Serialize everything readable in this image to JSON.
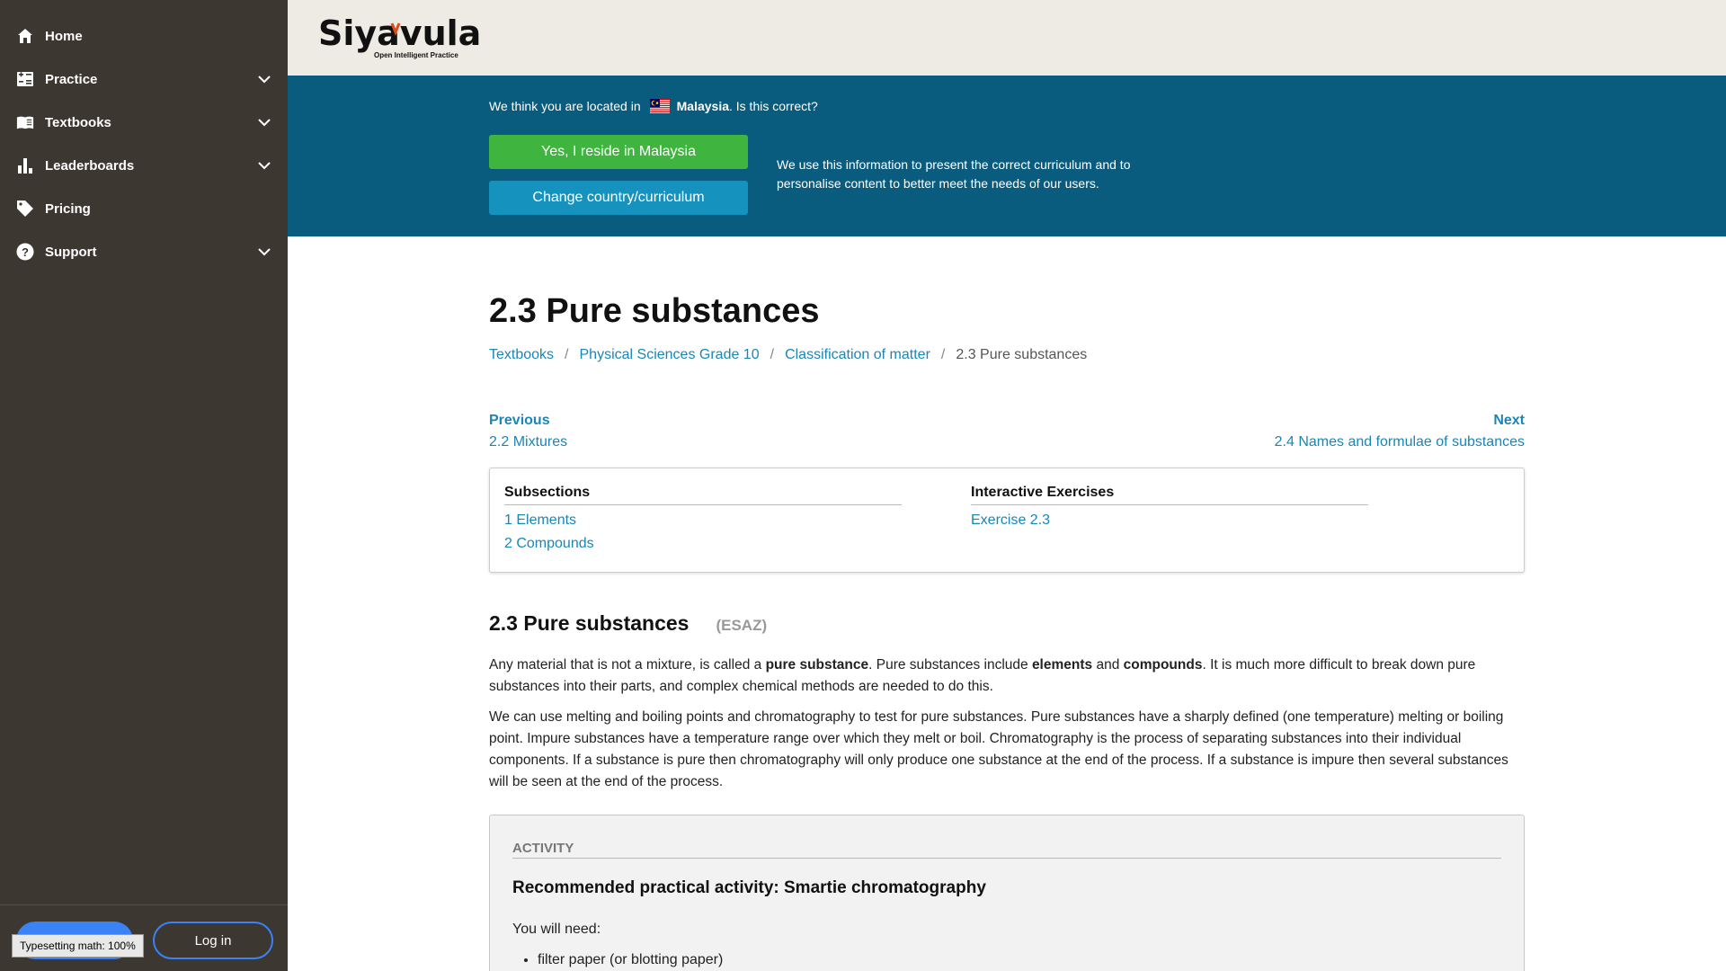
{
  "sidebar": {
    "items": [
      {
        "label": "Home",
        "icon": "home-icon"
      },
      {
        "label": "Practice",
        "icon": "practice-icon"
      },
      {
        "label": "Textbooks",
        "icon": "book-icon"
      },
      {
        "label": "Leaderboards",
        "icon": "bar-chart-icon"
      },
      {
        "label": "Pricing",
        "icon": "tag-icon"
      },
      {
        "label": "Support",
        "icon": "help-icon"
      }
    ],
    "login_label": "Log in",
    "typesetting_tip": "Typesetting math: 100%"
  },
  "header": {
    "logo_text": "Siyavula",
    "logo_tagline": "Open Intelligent Practice"
  },
  "banner": {
    "question_prefix": "We think you are located in",
    "country": "Malaysia",
    "question_suffix": ". Is this correct?",
    "yes_label": "Yes, I reside in Malaysia",
    "change_label": "Change country/curriculum",
    "info": "We use this information to present the correct curriculum and to personalise content to better meet the needs of our users."
  },
  "page": {
    "title": "2.3 Pure substances",
    "breadcrumb": [
      "Textbooks",
      "Physical Sciences Grade 10",
      "Classification of matter",
      "2.3 Pure substances"
    ],
    "prev_label": "Previous",
    "prev_title": "2.2 Mixtures",
    "next_label": "Next",
    "next_title": "2.4 Names and formulae of substances"
  },
  "toc": {
    "subsections_title": "Subsections",
    "subsections": [
      "1 Elements",
      "2 Compounds"
    ],
    "exercises_title": "Interactive Exercises",
    "exercises": [
      "Exercise 2.3"
    ]
  },
  "section": {
    "title": "2.3 Pure substances",
    "code": "(ESAZ)",
    "p1_a": "Any material that is not a mixture, is called a ",
    "p1_b": "pure substance",
    "p1_c": ". Pure substances include ",
    "p1_d": "elements",
    "p1_e": " and ",
    "p1_f": "compounds",
    "p1_g": ". It is much more difficult to break down pure substances into their parts, and complex chemical methods are needed to do this.",
    "p2": "We can use melting and boiling points and chromatography to test for pure substances. Pure substances have a sharply defined (one temperature) melting or boiling point. Impure substances have a temperature range over which they melt or boil. Chromatography is the process of separating substances into their individual components. If a substance is pure then chromatography will only produce one substance at the end of the process. If a substance is impure then several substances will be seen at the end of the process."
  },
  "activity": {
    "heading": "ACTIVITY",
    "title": "Recommended practical activity: Smartie chromatography",
    "need": "You will need:",
    "items": [
      "filter paper (or blotting paper)"
    ]
  },
  "colors": {
    "sidebar_bg": "#3c3731",
    "header_bg": "#eeebe4",
    "banner_bg": "#0a5c7f",
    "yes_button": "#3fb53f",
    "change_button": "#1592bd",
    "link": "#1a86b8",
    "accent": "#3b82f6"
  }
}
